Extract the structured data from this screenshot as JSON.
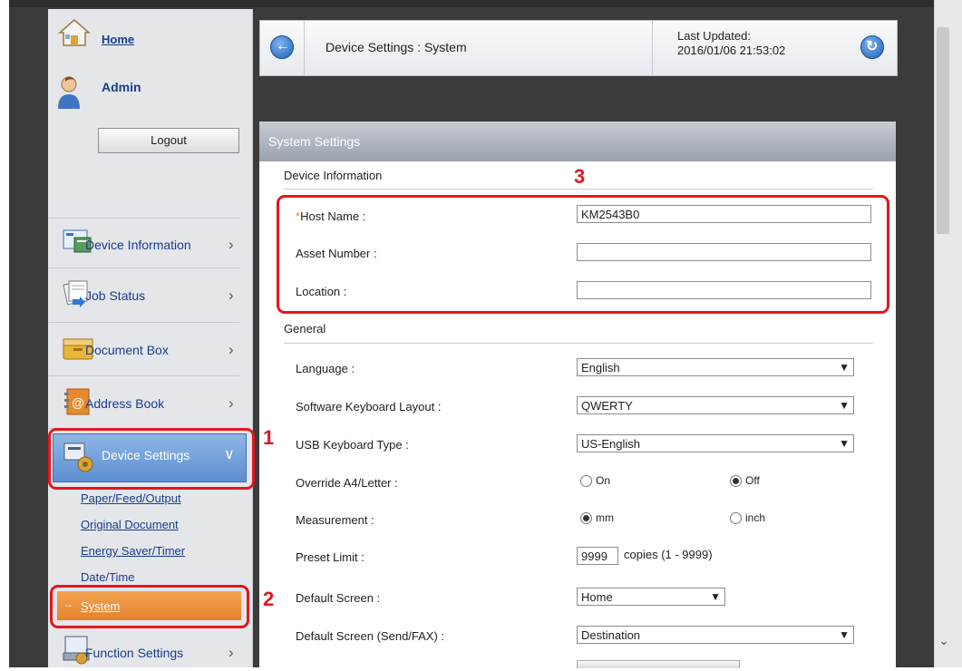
{
  "header": {
    "title": "Device Settings : System",
    "last_updated_label": "Last Updated:",
    "last_updated_value": "2016/01/06 21:53:02"
  },
  "sidebar": {
    "home_label": "Home",
    "user_label": "Admin",
    "logout_label": "Logout",
    "items": [
      {
        "label": "Device Information"
      },
      {
        "label": "Job Status"
      },
      {
        "label": "Document Box"
      },
      {
        "label": "Address Book"
      },
      {
        "label": "Device Settings"
      },
      {
        "label": "Function Settings"
      }
    ],
    "sub_items": [
      {
        "label": "Paper/Feed/Output"
      },
      {
        "label": "Original Document"
      },
      {
        "label": "Energy Saver/Timer"
      },
      {
        "label": "Date/Time"
      },
      {
        "label": "System"
      }
    ]
  },
  "panel": {
    "title": "System Settings",
    "device_info_heading": "Device Information",
    "general_heading": "General",
    "host_name_label": "Host Name :",
    "host_name_value": "KM2543B0",
    "asset_number_label": "Asset Number :",
    "asset_number_value": "",
    "location_label": "Location :",
    "location_value": "",
    "language_label": "Language :",
    "language_value": "English",
    "keyboard_layout_label": "Software Keyboard Layout :",
    "keyboard_layout_value": "QWERTY",
    "usb_keyboard_label": "USB Keyboard Type :",
    "usb_keyboard_value": "US-English",
    "override_label": "Override A4/Letter :",
    "override_on": "On",
    "override_off": "Off",
    "measurement_label": "Measurement :",
    "measurement_mm": "mm",
    "measurement_inch": "inch",
    "preset_limit_label": "Preset Limit :",
    "preset_limit_value": "9999",
    "preset_limit_suffix": "copies (1 - 9999)",
    "default_screen_label": "Default Screen :",
    "default_screen_value": "Home",
    "default_screen_fax_label": "Default Screen (Send/FAX) :",
    "default_screen_fax_value": "Destination"
  },
  "callouts": {
    "one": "1",
    "two": "2",
    "three": "3"
  },
  "colors": {
    "callout": "#e4161d",
    "selected_nav": "#5c8ed1",
    "selected_sub": "#e6812c"
  }
}
